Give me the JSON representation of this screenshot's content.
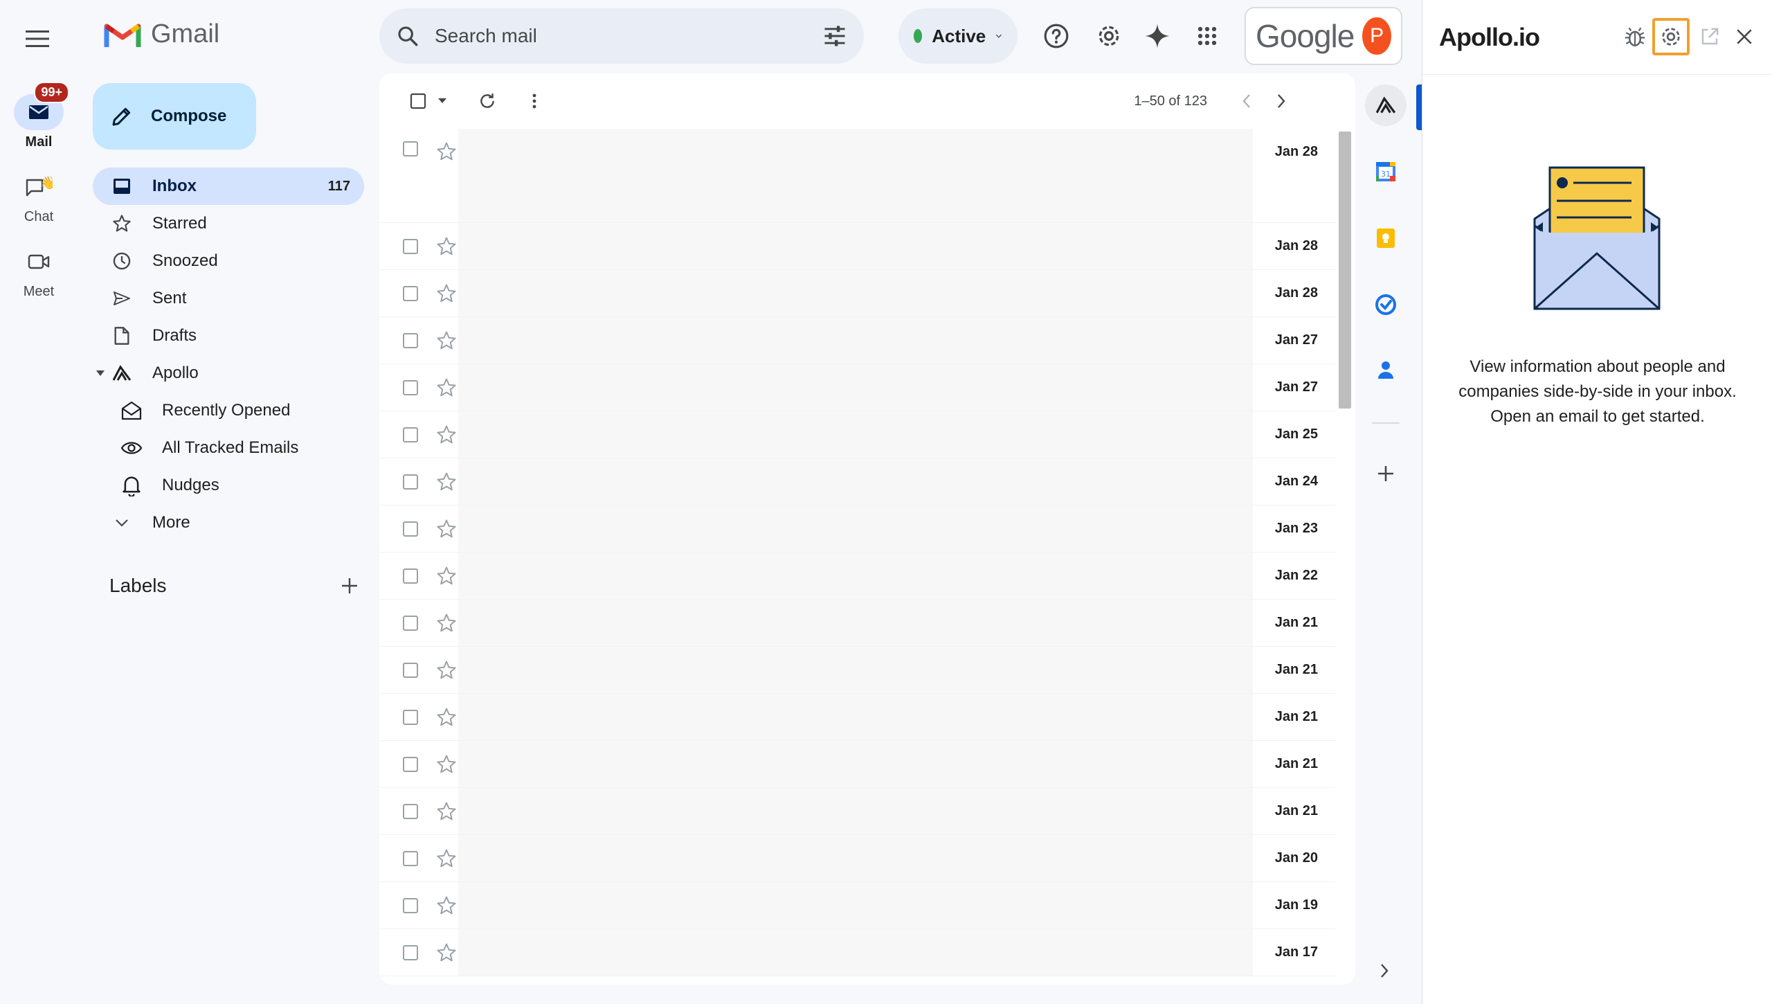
{
  "header": {
    "app_name": "Gmail",
    "search_placeholder": "Search mail",
    "status_label": "Active",
    "google_word": "Google",
    "avatar_initial": "P"
  },
  "rail": {
    "items": [
      {
        "label": "Mail",
        "badge": "99+"
      },
      {
        "label": "Chat"
      },
      {
        "label": "Meet"
      }
    ]
  },
  "nav": {
    "compose_label": "Compose",
    "items": [
      {
        "label": "Inbox",
        "count": "117"
      },
      {
        "label": "Starred"
      },
      {
        "label": "Snoozed"
      },
      {
        "label": "Sent"
      },
      {
        "label": "Drafts"
      },
      {
        "label": "Apollo"
      }
    ],
    "apollo_items": [
      {
        "label": "Recently Opened"
      },
      {
        "label": "All Tracked Emails"
      },
      {
        "label": "Nudges"
      }
    ],
    "more_label": "More",
    "labels_title": "Labels"
  },
  "toolbar": {
    "pager_text": "1–50 of 123"
  },
  "emails": [
    {
      "date": "Jan 28"
    },
    {
      "date": "Jan 28"
    },
    {
      "date": "Jan 28"
    },
    {
      "date": "Jan 27"
    },
    {
      "date": "Jan 27"
    },
    {
      "date": "Jan 25"
    },
    {
      "date": "Jan 24"
    },
    {
      "date": "Jan 23"
    },
    {
      "date": "Jan 22"
    },
    {
      "date": "Jan 21"
    },
    {
      "date": "Jan 21"
    },
    {
      "date": "Jan 21"
    },
    {
      "date": "Jan 21"
    },
    {
      "date": "Jan 21"
    },
    {
      "date": "Jan 20"
    },
    {
      "date": "Jan 19"
    },
    {
      "date": "Jan 17"
    }
  ],
  "apollo": {
    "logo_text": "Apollo.io",
    "message": "View information about people and companies side-by-side in your inbox. Open an email to get started."
  },
  "colors": {
    "accent_blue": "#0b57d0",
    "compose_bg": "#c2e7ff",
    "active_bg": "#d3e3fd",
    "status_green": "#34a853",
    "avatar_orange": "#f4511e",
    "highlight_orange": "#f0a030"
  }
}
